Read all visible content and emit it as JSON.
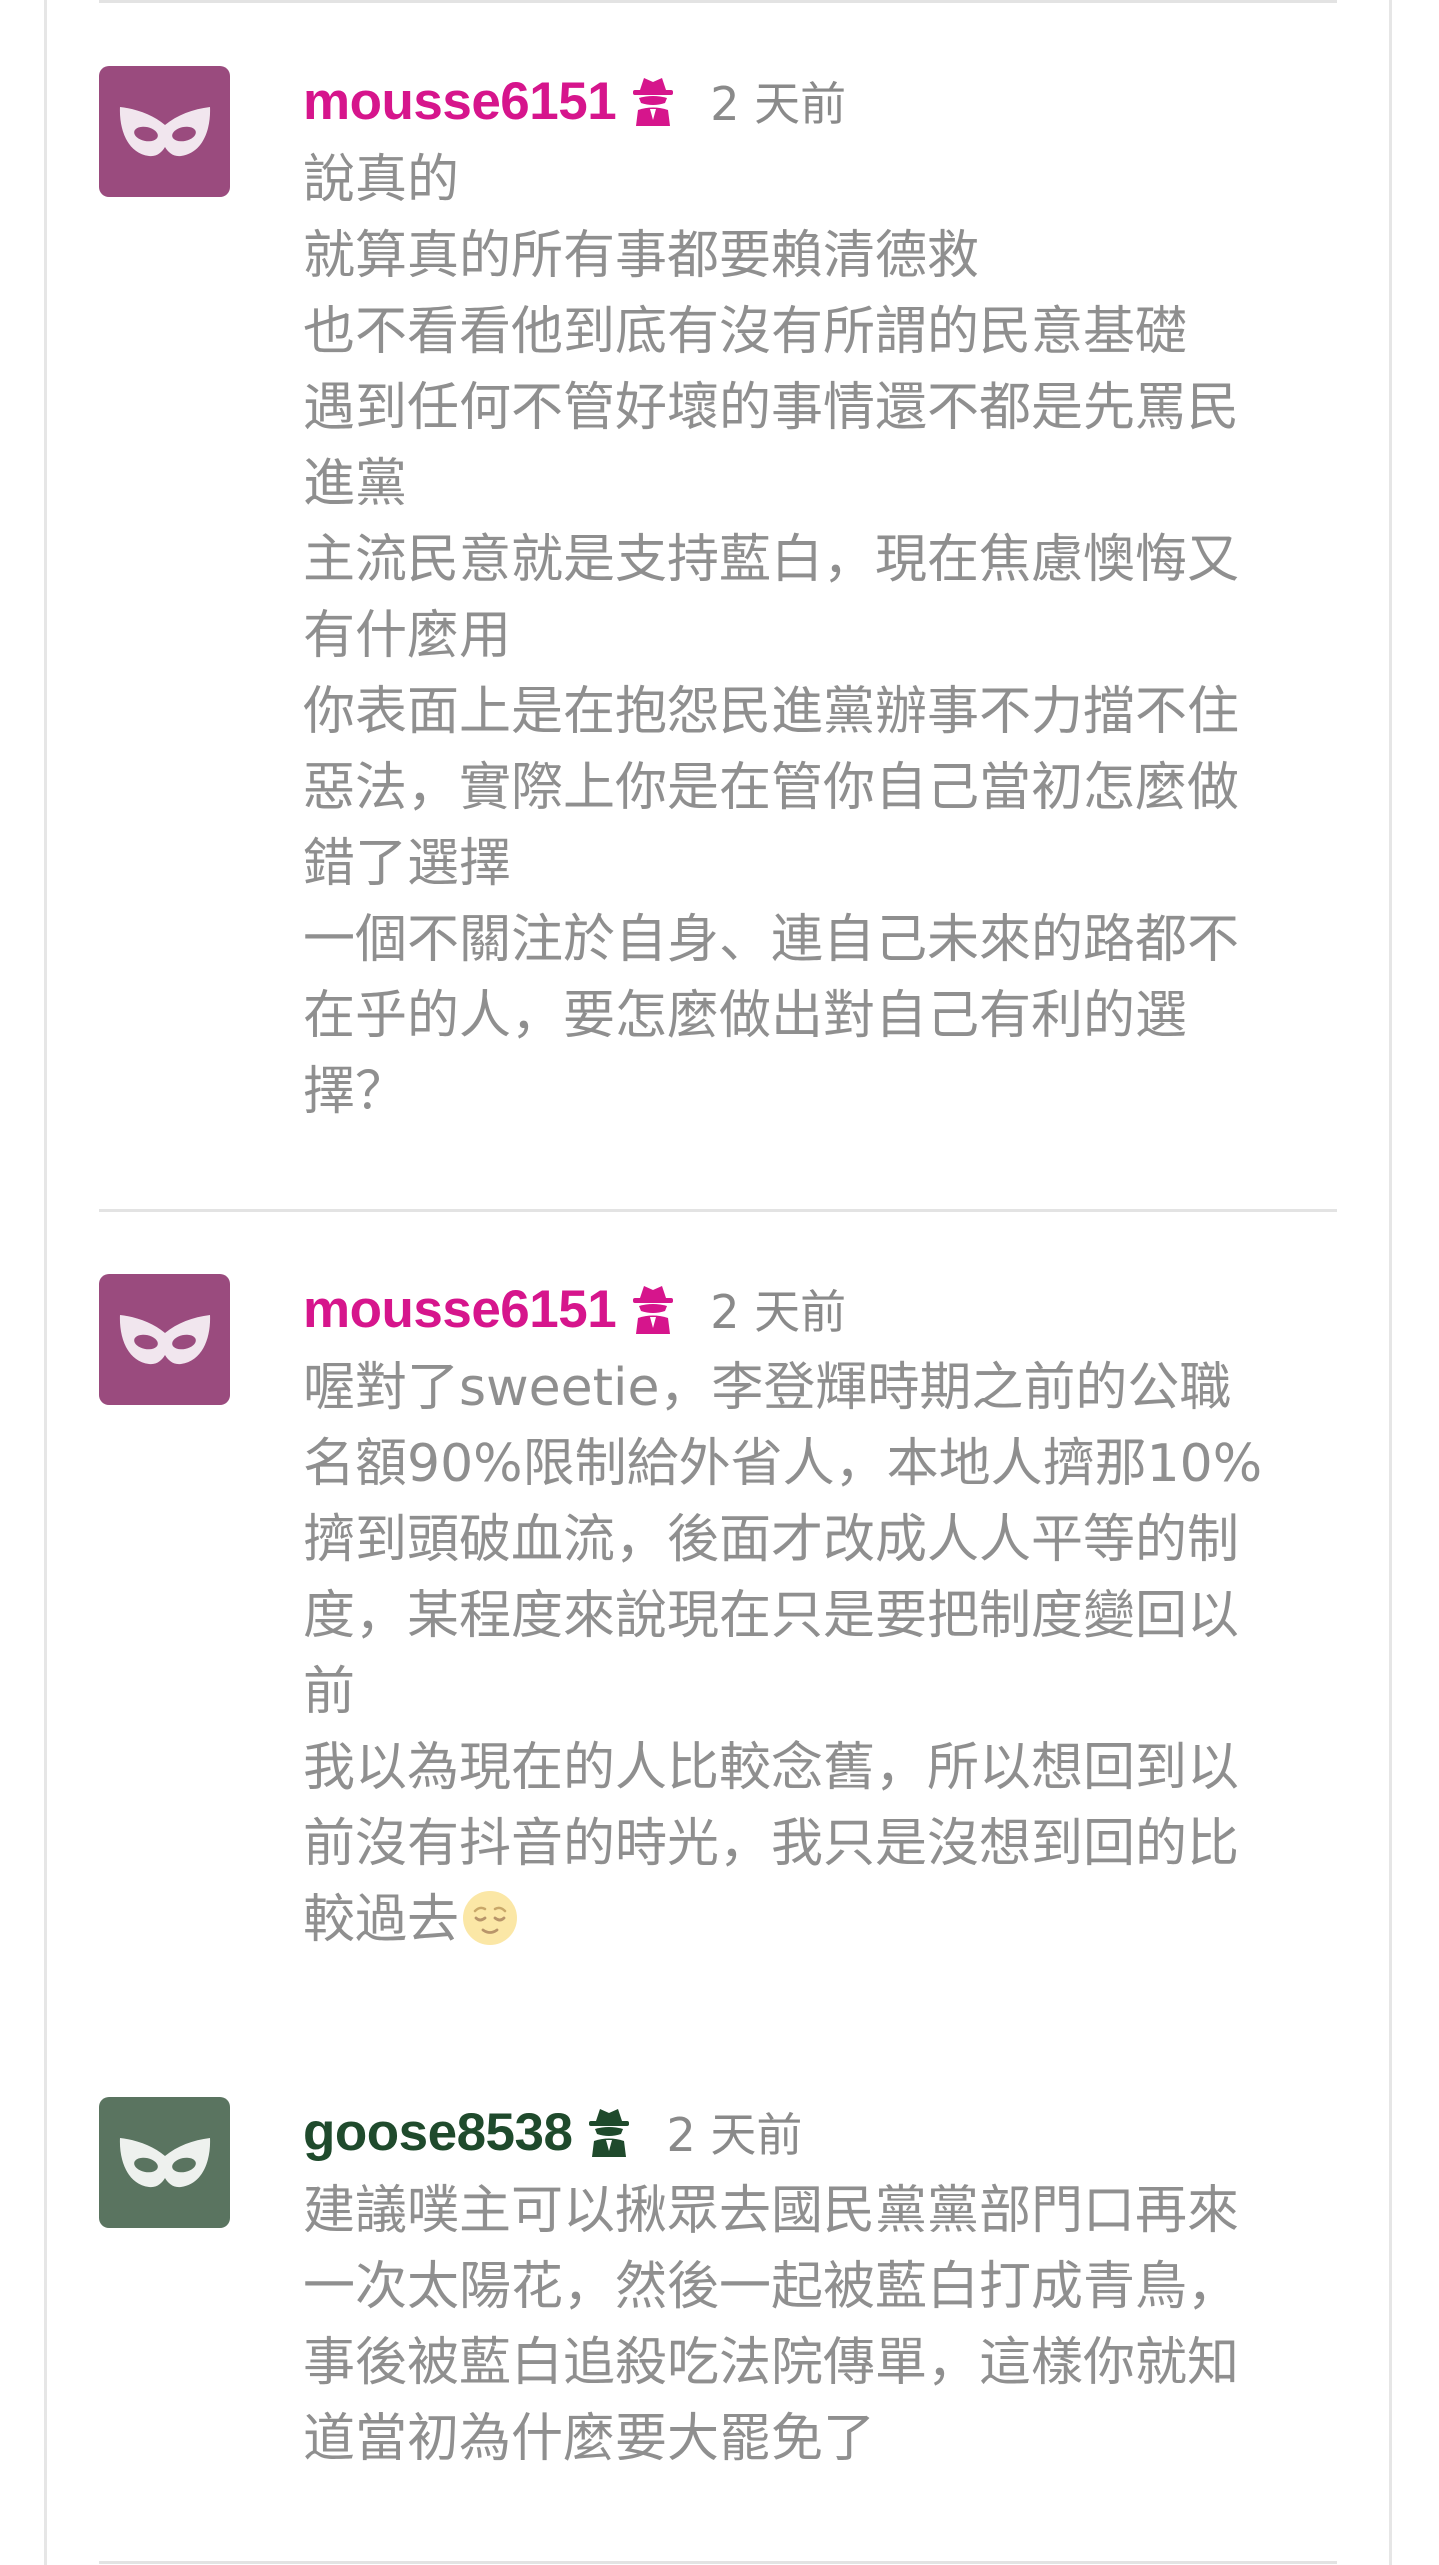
{
  "colors": {
    "pink_accent": "#d6158c",
    "pink_avatar": "#9a4b7e",
    "green_accent": "#1f4a2c",
    "green_avatar": "#5a7460",
    "body_text": "#8f8f8f",
    "time_text": "#8a8a8a"
  },
  "comments": [
    {
      "username": "mousse6151",
      "badge_icon": "spy-icon",
      "time": "2 天前",
      "lines": [
        "說真的",
        "就算真的所有事都要賴清德救",
        "也不看看他到底有沒有所謂的民意基礎",
        "遇到任何不管好壞的事情還不都是先罵民",
        "進黨",
        "主流民意就是支持藍白，現在焦慮懊悔又",
        "有什麼用",
        "你表面上是在抱怨民進黨辦事不力擋不住",
        "惡法，實際上你是在管你自己當初怎麼做",
        "錯了選擇",
        "一個不關注於自身、連自己未來的路都不",
        "在乎的人，要怎麼做出對自己有利的選",
        "擇？"
      ]
    },
    {
      "username": "mousse6151",
      "badge_icon": "spy-icon",
      "time": "2 天前",
      "lines": [
        "喔對了sweetie，李登輝時期之前的公職",
        "名額90%限制給外省人，本地人擠那10%",
        "擠到頭破血流，後面才改成人人平等的制",
        "度，某程度來說現在只是要把制度變回以",
        "前",
        "我以為現在的人比較念舊，所以想回到以",
        "前沒有抖音的時光，我只是沒想到回的比",
        "較過去"
      ],
      "trailing_emoji": "relieved-face-emoji"
    },
    {
      "username": "goose8538",
      "badge_icon": "spy-icon",
      "time": "2 天前",
      "lines": [
        "建議噗主可以揪眾去國民黨黨部門口再來",
        "一次太陽花，然後一起被藍白打成青鳥，",
        "事後被藍白追殺吃法院傳單，這樣你就知",
        "道當初為什麼要大罷免了"
      ]
    }
  ]
}
